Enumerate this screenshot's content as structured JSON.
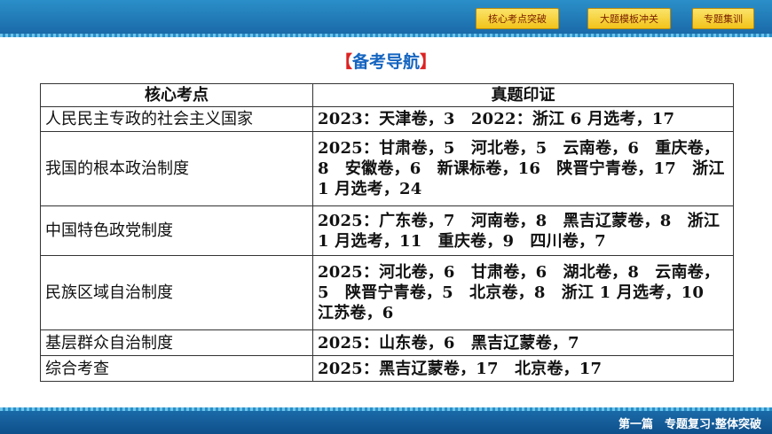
{
  "nav": {
    "tabs": [
      "核心考点突破",
      "大题模板冲关",
      "专题集训"
    ]
  },
  "heading": {
    "open": "【",
    "text": "备考导航",
    "close": "】"
  },
  "table": {
    "headers": [
      "核心考点",
      "真题印证"
    ],
    "rows": [
      {
        "topic": "人民民主专政的社会主义国家",
        "evidence": "2023：天津卷，3　2022：浙江 6 月选考，17"
      },
      {
        "topic": "我国的根本政治制度",
        "evidence": "2025：甘肃卷，5　河北卷，5　云南卷，6　重庆卷，8　安徽卷，6　新课标卷，16　陕晋宁青卷，17　浙江 1 月选考，24"
      },
      {
        "topic": "中国特色政党制度",
        "evidence": "2025：广东卷，7　河南卷，8　黑吉辽蒙卷，8　浙江 1 月选考，11　重庆卷，9　四川卷，7"
      },
      {
        "topic": "民族区域自治制度",
        "evidence": "2025：河北卷，6　甘肃卷，6　湖北卷，8　云南卷，5　陕晋宁青卷，5　北京卷，8　浙江 1 月选考，10　江苏卷，6"
      },
      {
        "topic": "基层群众自治制度",
        "evidence": "2025：山东卷，6　黑吉辽蒙卷，7"
      },
      {
        "topic": "综合考查",
        "evidence": "2025：黑吉辽蒙卷，17　北京卷，17"
      }
    ]
  },
  "footer": {
    "label": "第一篇　专题复习·整体突破"
  },
  "colors": {
    "header_blue": "#1a6aa8",
    "tab_yellow": "#f2c31a",
    "heading_blue": "#1565c0",
    "bracket_red": "#dd2222"
  }
}
